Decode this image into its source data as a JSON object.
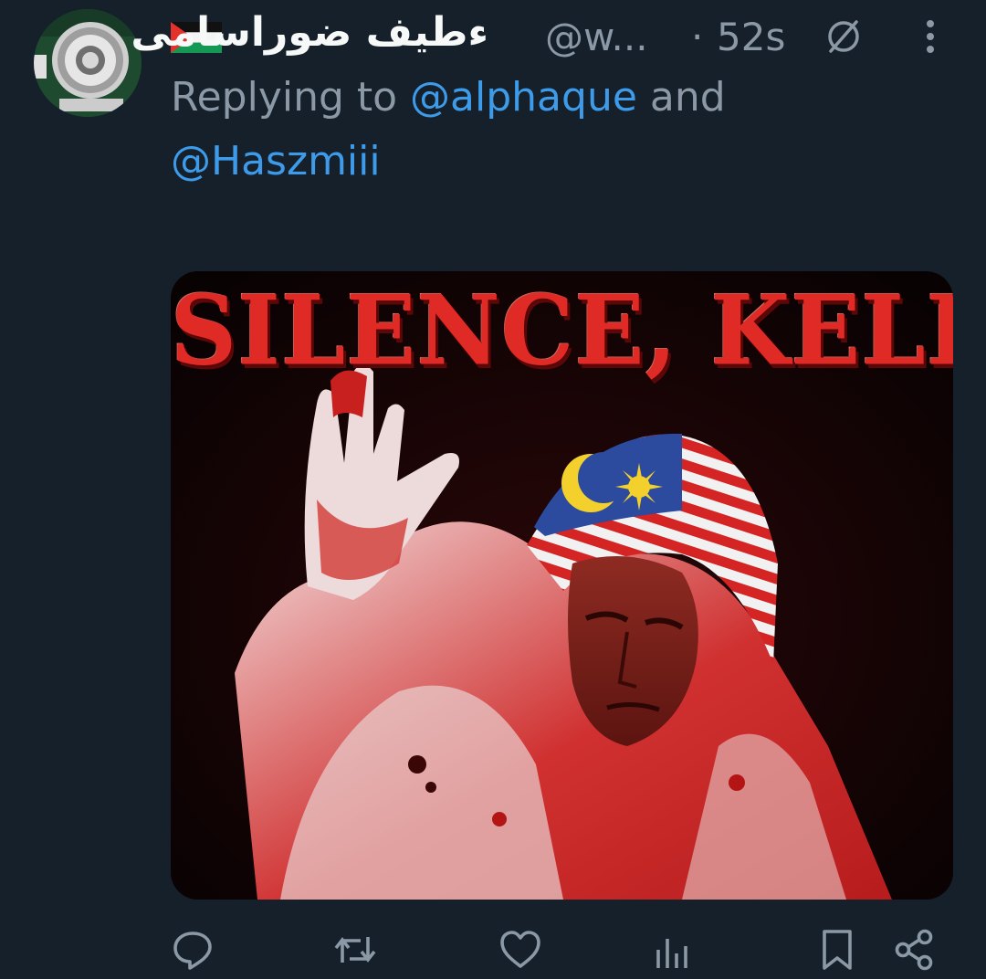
{
  "tweet": {
    "display_name": "ءطيف ضوراسامى",
    "handle": "@w...",
    "separator": "·",
    "timestamp": "52s",
    "reply": {
      "prefix": "Replying to ",
      "mention_1": "@alphaque",
      "joiner": " and",
      "mention_2": "@Haszmiii"
    },
    "media": {
      "caption": "SILENCE, KELING"
    },
    "actions": {
      "icons": [
        "reply-icon",
        "retweet-icon",
        "like-icon",
        "views-icon",
        "bookmark-icon",
        "share-icon"
      ]
    }
  },
  "colors": {
    "background": "#15202b",
    "text_secondary": "#8b98a5",
    "link": "#3d9be9",
    "caption_red": "#e02a25"
  }
}
